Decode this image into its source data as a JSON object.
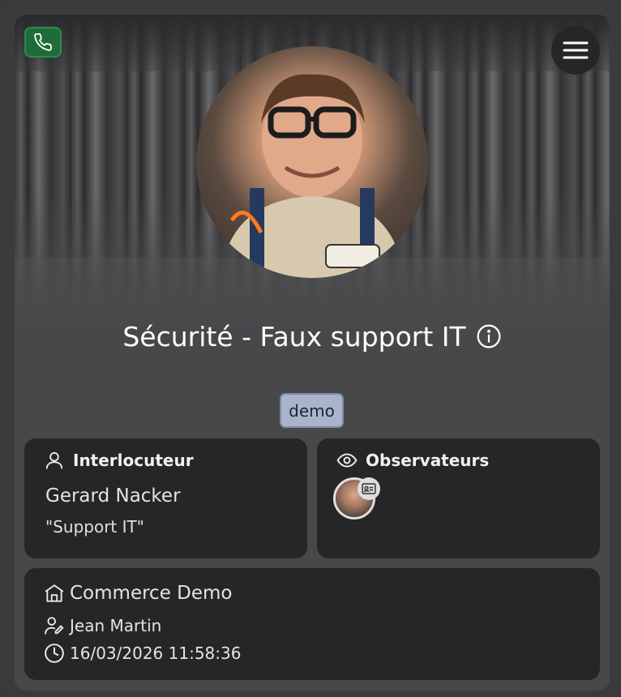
{
  "header": {
    "title": "Sécurité - Faux support IT",
    "tag": "demo"
  },
  "icons": {
    "phone": "phone-icon",
    "menu": "hamburger-menu-icon",
    "info": "info-icon"
  },
  "colors": {
    "phone_button": "#1f6b3a",
    "tag_background": "#a9b4cc",
    "panel_background": "#262628"
  },
  "interlocutor": {
    "heading": "Interlocuteur",
    "name": "Gerard Nacker",
    "role": "\"Support IT\""
  },
  "observers": {
    "heading": "Observateurs"
  },
  "details": {
    "company": "Commerce Demo",
    "user": "Jean Martin",
    "datetime": "16/03/2026 11:58:36"
  }
}
